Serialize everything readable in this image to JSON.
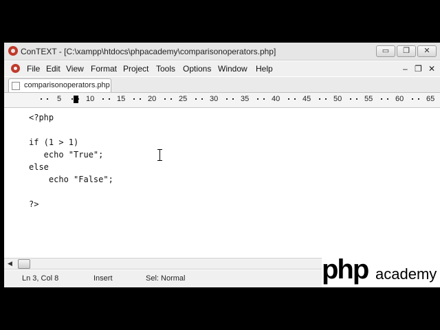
{
  "window": {
    "title": "ConTEXT - [C:\\xampp\\htdocs\\phpacademy\\comparisonoperators.php]",
    "controls": {
      "minimize": "▭",
      "maximize": "❐",
      "close": "✕"
    }
  },
  "menu": {
    "items": [
      "File",
      "Edit",
      "View",
      "Format",
      "Project",
      "Tools",
      "Options",
      "Window",
      "Help"
    ],
    "mdi_controls": {
      "minimize": "–",
      "restore": "❐",
      "close": "✕"
    }
  },
  "tab": {
    "label": "comparisonoperators.php"
  },
  "ruler": {
    "labels": [
      "5",
      "10",
      "15",
      "20",
      "25",
      "30",
      "35",
      "40",
      "45",
      "50",
      "55",
      "60",
      "65"
    ]
  },
  "editor": {
    "lines": [
      "<?php",
      "",
      "if (1 > 1)",
      "   echo \"True\";",
      "else",
      "    echo \"False\";",
      "",
      "?>"
    ]
  },
  "scrollbar": {
    "left_arrow": "◀"
  },
  "status": {
    "position": "Ln 3, Col 8",
    "mode": "Insert",
    "selection": "Sel: Normal"
  },
  "watermark": {
    "php": "php",
    "academy": "academy"
  },
  "colors": {
    "icon_red": "#c0392b"
  }
}
